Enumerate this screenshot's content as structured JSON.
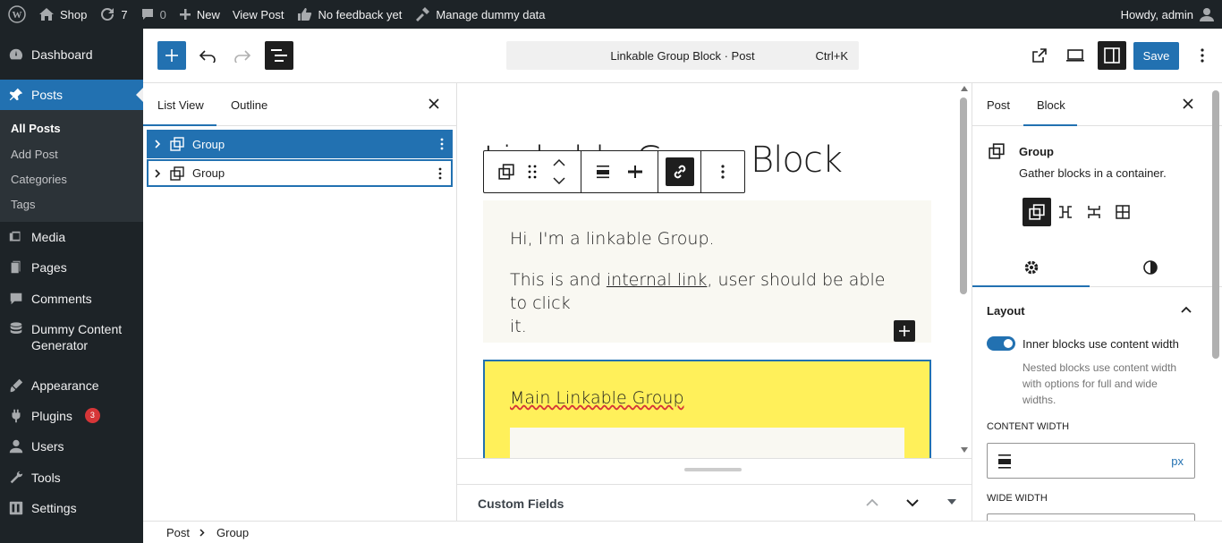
{
  "adminbar": {
    "site_name": "Shop",
    "updates_count": "7",
    "comments_count": "0",
    "new_label": "New",
    "view_post_label": "View Post",
    "feedback_label": "No feedback yet",
    "dummy_label": "Manage dummy data",
    "howdy": "Howdy, admin"
  },
  "menu": {
    "dashboard": "Dashboard",
    "posts": "Posts",
    "sub": [
      "All Posts",
      "Add Post",
      "Categories",
      "Tags"
    ],
    "media": "Media",
    "pages": "Pages",
    "comments": "Comments",
    "dummy_line1": "Dummy Content",
    "dummy_line2": "Generator",
    "appearance": "Appearance",
    "plugins": "Plugins",
    "plugins_badge": "3",
    "users": "Users",
    "tools": "Tools",
    "settings": "Settings"
  },
  "header": {
    "doc_title": "Linkable Group Block · Post",
    "shortcut": "Ctrl+K",
    "save_label": "Save"
  },
  "listview": {
    "tabs": [
      "List View",
      "Outline"
    ],
    "rows": [
      {
        "label": "Group",
        "selected": true
      },
      {
        "label": "Group",
        "selected": false
      }
    ]
  },
  "canvas": {
    "title": "Linkable Group Block",
    "para1": "Hi, I'm a linkable Group.",
    "para2_before": "This is and ",
    "para2_link": "internal link",
    "para2_after": ", user should be able to click",
    "para2_wrap": "it.",
    "group2_heading": "Main Linkable Group"
  },
  "metabox": {
    "title": "Custom Fields"
  },
  "sidebar": {
    "tabs": [
      "Post",
      "Block"
    ],
    "block_title": "Group",
    "block_desc": "Gather blocks in a container.",
    "panel_title": "Layout",
    "toggle_label": "Inner blocks use content width",
    "help_text": "Nested blocks use content width with options for full and wide widths.",
    "content_width_label": "CONTENT WIDTH",
    "content_width_unit": "px",
    "wide_width_label": "WIDE WIDTH"
  },
  "footer": {
    "crumbs": [
      "Post",
      "Group"
    ]
  },
  "colors": {
    "admin_dark": "#1d2327",
    "accent": "#2271b1",
    "yellow": "#fff05a",
    "cream": "#f9f8f2"
  }
}
